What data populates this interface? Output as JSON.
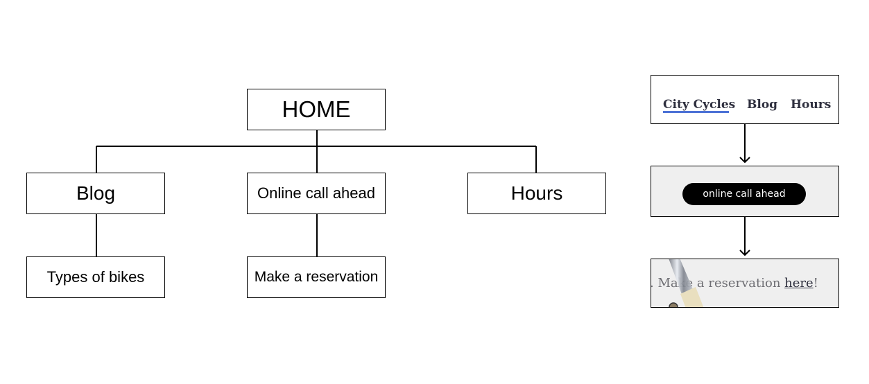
{
  "sitemap": {
    "root": "HOME",
    "children": [
      {
        "label": "Blog",
        "children": [
          {
            "label": "Types of bikes"
          }
        ]
      },
      {
        "label": "Online call ahead",
        "children": [
          {
            "label": "Make a reservation"
          }
        ]
      },
      {
        "label": "Hours",
        "children": []
      }
    ]
  },
  "flow": {
    "nav": {
      "items": [
        "City Cycles",
        "Blog",
        "Hours"
      ],
      "active": "City Cycles",
      "underline_color": "#4d72d6"
    },
    "call_ahead_button": "online call ahead",
    "reservation": {
      "prefix": ". Make a reservation ",
      "link": "here",
      "suffix": "!"
    }
  },
  "icons": {
    "arrow": "arrow-down-icon",
    "image": "bike-photo"
  }
}
